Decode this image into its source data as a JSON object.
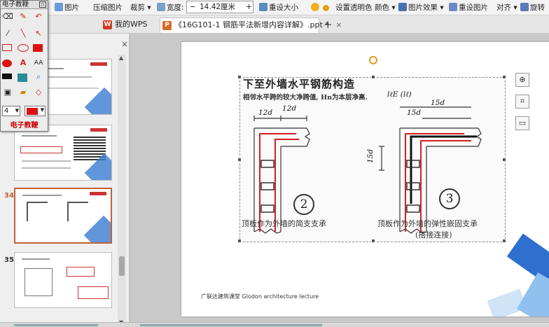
{
  "ribbon": {
    "picture_label": "图片",
    "compress_label": "压缩图片",
    "crop_label": "裁剪",
    "width_label": "宽度:",
    "width_minus": "−",
    "width_value": "14.42厘米",
    "width_plus": "+",
    "reset_size_label": "重设大小",
    "set_transparent_label": "设置透明色",
    "color_label": "颜色",
    "picture_effect_label": "图片效果",
    "reset_picture_label": "重设图片",
    "align_label": "对齐",
    "rotate_label": "旋转"
  },
  "tabs": [
    {
      "label": "我的WPS",
      "icon": "W"
    },
    {
      "label": "《16G101-1 钢筋平法新增内容详解》.ppt *",
      "icon": "P",
      "close": "×"
    }
  ],
  "tab_add": "+",
  "palette": {
    "title": "电子教鞭",
    "pen_width": "4",
    "footer": "电子教鞭",
    "aa_label": "AA",
    "a_label": "A"
  },
  "thumbnails": {
    "close": "×",
    "slide_numbers": [
      "34",
      "35"
    ]
  },
  "slide": {
    "figure_heading": "下至外墙水平钢筋构造",
    "figure_subtitle": "相邻水平跨的较大净跨值, Hn为本层净高.",
    "dim_12d_left": "12d",
    "dim_12d_right": "12d",
    "dim_lle": "lℓE (lℓ)",
    "dim_15d_a": "15d",
    "dim_15d_b": "15d",
    "dim_15d_vert": "15d",
    "circle_2": "2",
    "circle_3": "3",
    "caption_left": "顶板作为外墙的简支支承",
    "caption_right_1": "顶板作为外墙的弹性嵌固支承",
    "caption_right_2": "(搭接连接)",
    "footer": "广联达建筑课堂   Glodon  architecture  lecture"
  },
  "colors": {
    "accent_orange": "#c0623a",
    "rebar_red": "#d22020",
    "brand_blue": "#2f6fd0"
  }
}
